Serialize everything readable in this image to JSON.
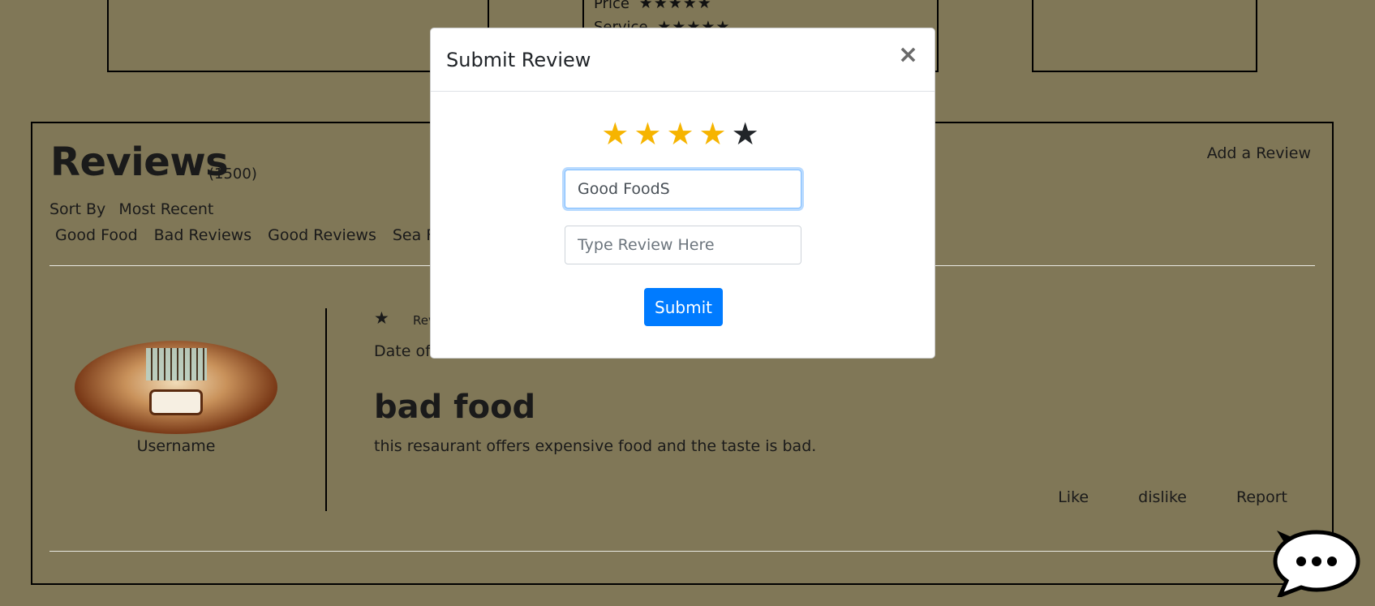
{
  "background_page": {
    "ratings": [
      {
        "label": "Price",
        "stars": "★★★★★"
      },
      {
        "label": "Service",
        "stars": "★★★★★"
      }
    ],
    "reviews": {
      "title": "Reviews",
      "count": "(1500)",
      "add_review": "Add a Review",
      "sort_label": "Sort By",
      "sort_value": "Most Recent",
      "filters": [
        "Good Food",
        "Bad Reviews",
        "Good Reviews",
        "Sea Foo"
      ]
    },
    "review_card": {
      "star": "★",
      "rev_label": "Rev",
      "date_label": "Date of",
      "username": "Username",
      "heading": "bad food",
      "body": "this resaurant offers expensive food and the taste is bad.",
      "actions": [
        "Like",
        "dislike",
        "Report"
      ]
    }
  },
  "modal": {
    "title": "Submit Review",
    "close_symbol": "×",
    "rating": 4,
    "max_rating": 5,
    "title_input_value": "Good FoodS",
    "review_input_placeholder": "Type Review Here",
    "submit_label": "Submit"
  },
  "colors": {
    "overlay": "#807757",
    "star_active": "#f6b400",
    "star_inactive": "#212529",
    "primary": "#007bff"
  }
}
